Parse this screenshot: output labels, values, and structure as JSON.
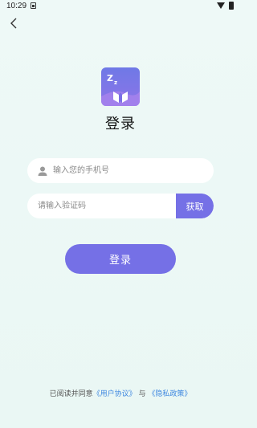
{
  "status_bar": {
    "time": "10:29"
  },
  "header": {
    "back_icon": "chevron-left-icon"
  },
  "app": {
    "logo_icon": "sleep-book-logo-icon"
  },
  "page": {
    "title": "登录"
  },
  "phone": {
    "placeholder": "输入您的手机号",
    "icon": "user-icon"
  },
  "code": {
    "placeholder": "请输入验证码",
    "get_label": "获取"
  },
  "login": {
    "label": "登录"
  },
  "agreement": {
    "prefix": "已阅读并同意",
    "user_agreement": "《用户协议》",
    "and": "与",
    "privacy_policy": "《隐私政策》"
  },
  "colors": {
    "accent": "#7570e6",
    "link": "#3f88e0",
    "background": "#eef9f7"
  }
}
